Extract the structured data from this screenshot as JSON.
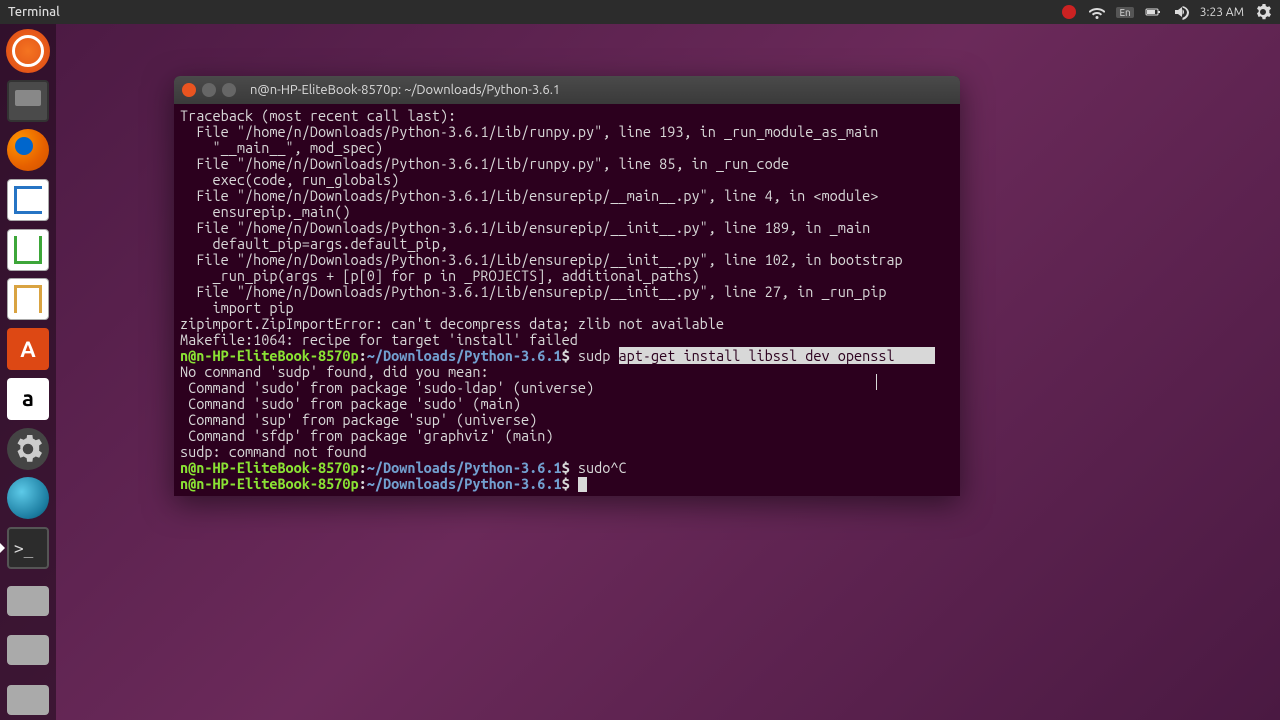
{
  "menubar": {
    "title": "Terminal",
    "lang": "En",
    "time": "3:23 AM"
  },
  "launcher": {
    "items": [
      {
        "name": "ubuntu-dash",
        "tooltip": "Dash"
      },
      {
        "name": "files",
        "tooltip": "Files"
      },
      {
        "name": "firefox",
        "tooltip": "Firefox"
      },
      {
        "name": "writer",
        "tooltip": "LibreOffice Writer"
      },
      {
        "name": "calc",
        "tooltip": "LibreOffice Calc"
      },
      {
        "name": "impress",
        "tooltip": "LibreOffice Impress"
      },
      {
        "name": "software",
        "tooltip": "Ubuntu Software"
      },
      {
        "name": "amazon",
        "tooltip": "Amazon",
        "glyph": "a"
      },
      {
        "name": "settings",
        "tooltip": "System Settings"
      },
      {
        "name": "globe",
        "tooltip": "Browser"
      },
      {
        "name": "terminal",
        "tooltip": "Terminal",
        "glyph": ">_",
        "running": true
      },
      {
        "name": "disk1",
        "tooltip": "Volume"
      },
      {
        "name": "disk2",
        "tooltip": "Volume"
      },
      {
        "name": "disk3",
        "tooltip": "Volume"
      }
    ]
  },
  "terminal": {
    "title": "n@n-HP-EliteBook-8570p: ~/Downloads/Python-3.6.1",
    "prompt_user": "n@n-HP-EliteBook-8570p",
    "prompt_path": "~/Downloads/Python-3.6.1",
    "lines": [
      "Traceback (most recent call last):",
      "  File \"/home/n/Downloads/Python-3.6.1/Lib/runpy.py\", line 193, in _run_module_as_main",
      "    \"__main__\", mod_spec)",
      "  File \"/home/n/Downloads/Python-3.6.1/Lib/runpy.py\", line 85, in _run_code",
      "    exec(code, run_globals)",
      "  File \"/home/n/Downloads/Python-3.6.1/Lib/ensurepip/__main__.py\", line 4, in <module>",
      "    ensurepip._main()",
      "  File \"/home/n/Downloads/Python-3.6.1/Lib/ensurepip/__init__.py\", line 189, in _main",
      "    default_pip=args.default_pip,",
      "  File \"/home/n/Downloads/Python-3.6.1/Lib/ensurepip/__init__.py\", line 102, in bootstrap",
      "    _run_pip(args + [p[0] for p in _PROJECTS], additional_paths)",
      "  File \"/home/n/Downloads/Python-3.6.1/Lib/ensurepip/__init__.py\", line 27, in _run_pip",
      "    import pip",
      "zipimport.ZipImportError: can't decompress data; zlib not available",
      "Makefile:1064: recipe for target 'install' failed"
    ],
    "cmd1_typed": " sudp ",
    "cmd1_sel": "apt-get install libssl dev openssl     ",
    "err_lines": [
      "No command 'sudp' found, did you mean:",
      " Command 'sudo' from package 'sudo-ldap' (universe)",
      " Command 'sudo' from package 'sudo' (main)",
      " Command 'sup' from package 'sup' (universe)",
      " Command 'sfdp' from package 'graphviz' (main)",
      "sudp: command not found"
    ],
    "cmd2_typed": " sudo^C",
    "cmd3_typed": " "
  }
}
